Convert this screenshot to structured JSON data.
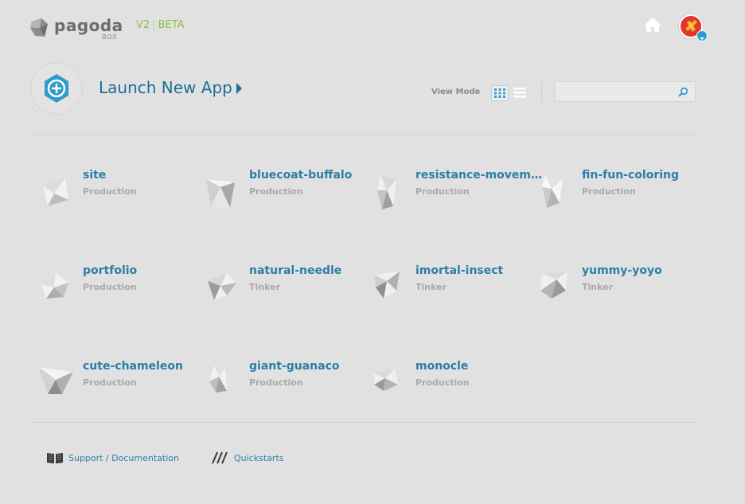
{
  "header": {
    "logo_text": "pagoda",
    "logo_sub": "BOX",
    "version_label": "V2",
    "version_stage": "BETA"
  },
  "launch": {
    "label": "Launch New App"
  },
  "toolbar": {
    "view_mode_label": "View Mode",
    "search_placeholder": ""
  },
  "apps": [
    {
      "name": "site",
      "env": "Production"
    },
    {
      "name": "bluecoat-buffalo",
      "env": "Production"
    },
    {
      "name": "resistance-movem...",
      "env": "Production"
    },
    {
      "name": "fin-fun-coloring",
      "env": "Production"
    },
    {
      "name": "portfolio",
      "env": "Production"
    },
    {
      "name": "natural-needle",
      "env": "Tinker"
    },
    {
      "name": "imortal-insect",
      "env": "Tinker"
    },
    {
      "name": "yummy-yoyo",
      "env": "Tinker"
    },
    {
      "name": "cute-chameleon",
      "env": "Production"
    },
    {
      "name": "giant-guanaco",
      "env": "Production"
    },
    {
      "name": "monocle",
      "env": "Production"
    }
  ],
  "footer": {
    "support_label": "Support / Documentation",
    "quickstarts_label": "Quickstarts"
  },
  "colors": {
    "accent": "#2a7fa7",
    "beta": "#8ec046",
    "background": "#e1e1e1"
  }
}
